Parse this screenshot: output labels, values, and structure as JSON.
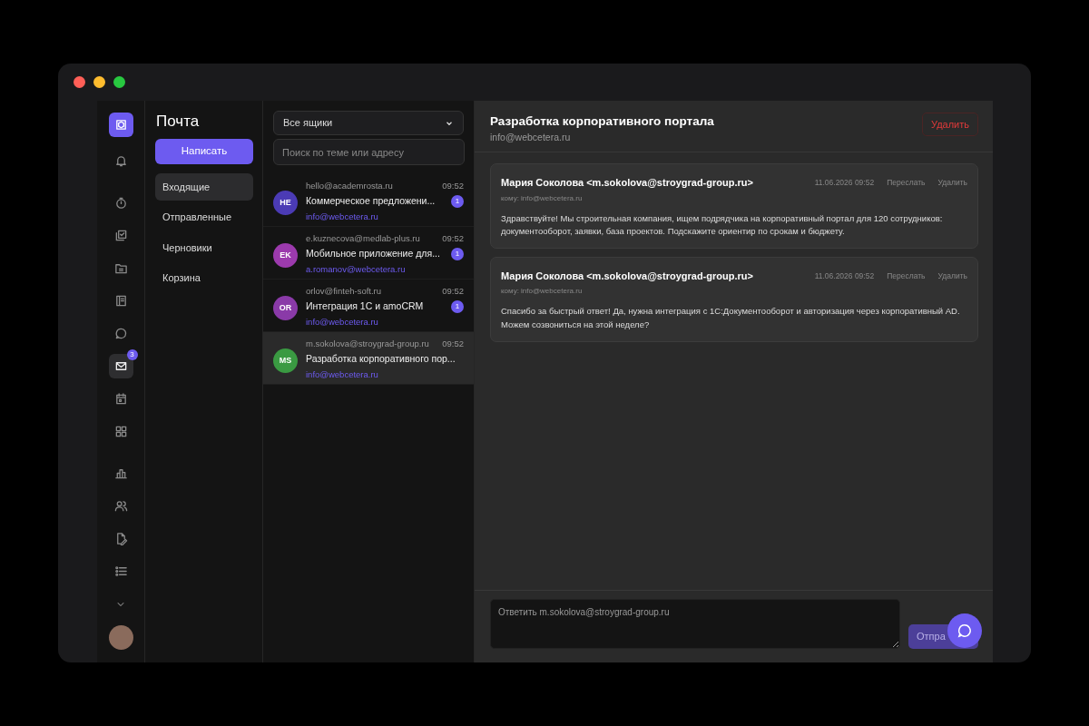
{
  "rail": {
    "items": [
      {
        "selected": false
      },
      {
        "selected": false
      },
      {
        "selected": false
      },
      {
        "selected": false
      },
      {
        "selected": false
      },
      {
        "selected": false
      },
      {
        "selected": true,
        "badge": "3"
      },
      {
        "selected": false
      },
      {
        "selected": false
      },
      {
        "selected": false
      },
      {
        "selected": false
      },
      {
        "selected": false
      },
      {
        "selected": false
      }
    ]
  },
  "folders": {
    "title": "Почта",
    "compose": "Написать",
    "items": [
      {
        "label": "Входящие",
        "selected": true
      },
      {
        "label": "Отправленные",
        "selected": false
      },
      {
        "label": "Черновики",
        "selected": false
      },
      {
        "label": "Корзина",
        "selected": false
      }
    ]
  },
  "mail_list": {
    "mailbox": "Все ящики",
    "search": {
      "placeholder": "Поиск по теме или адресу"
    },
    "items": [
      {
        "initials": "HE",
        "color": "#4b3bb5",
        "from": "hello@academrosta.ru",
        "time": "09:52",
        "subject": "Коммерческое предложени...",
        "to": "info@webcetera.ru",
        "unread": "1",
        "selected": false
      },
      {
        "initials": "EK",
        "color": "#9c3aad",
        "from": "e.kuznecova@medlab-plus.ru",
        "time": "09:52",
        "subject": "Мобильное приложение для...",
        "to": "a.romanov@webcetera.ru",
        "unread": "1",
        "selected": false
      },
      {
        "initials": "OR",
        "color": "#8a3aa8",
        "from": "orlov@finteh-soft.ru",
        "time": "09:52",
        "subject": "Интеграция 1С и amoCRM",
        "to": "info@webcetera.ru",
        "unread": "1",
        "selected": false
      },
      {
        "initials": "MS",
        "color": "#3a9a42",
        "from": "m.sokolova@stroygrad-group.ru",
        "time": "09:52",
        "subject": "Разработка корпоративного пор...",
        "to": "info@webcetera.ru",
        "selected": true
      }
    ]
  },
  "reader": {
    "subject": "Разработка корпоративного портала",
    "mailbox": "info@webcetera.ru",
    "delete": "Удалить",
    "messages": [
      {
        "sender": "Мария Соколова <m.sokolova@stroygrad-group.ru>",
        "date": "11.06.2026 09:52",
        "actions": [
          "Переслать",
          "Удалить"
        ],
        "to": "кому: info@webcetera.ru",
        "body": "Здравствуйте! Мы строительная компания, ищем подрядчика на корпоративный портал для 120 сотрудников: документооборот, заявки, база проектов. Подскажите ориентир по срокам и бюджету."
      },
      {
        "sender": "Мария Соколова <m.sokolova@stroygrad-group.ru>",
        "date": "11.06.2026 09:52",
        "actions": [
          "Переслать",
          "Удалить"
        ],
        "to": "кому: info@webcetera.ru",
        "body": "Спасибо за быстрый ответ! Да, нужна интеграция с 1С:Документооборот и авторизация через корпоративный AD. Можем созвониться на этой неделе?"
      }
    ],
    "reply": {
      "placeholder": "Ответить m.sokolova@stroygrad-group.ru",
      "send": "Отпра"
    }
  }
}
